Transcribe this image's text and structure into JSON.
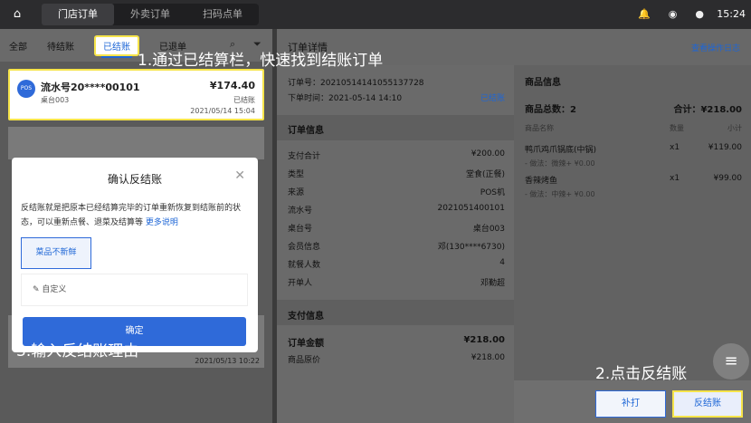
{
  "topbar": {
    "tabs": [
      "门店订单",
      "外卖订单",
      "扫码点单"
    ],
    "time": "15:24"
  },
  "left": {
    "tabs": [
      "全部",
      "待结账",
      "已结账",
      "已退单"
    ],
    "card": {
      "badge": "POS",
      "serial": "流水号20****00101",
      "table": "桌台003",
      "amount": "¥174.40",
      "status": "已结账",
      "time": "2021/05/14 15:04"
    },
    "ghost_time": "2021/05/13 10:22",
    "dialog": {
      "title": "确认反结账",
      "desc": "反结账就是把原本已经结算完毕的订单重新恢复到结账前的状态，可以重新点餐、退菜及结算等",
      "link": "更多说明",
      "reason": "菜品不新鲜",
      "custom": "自定义",
      "confirm": "确定"
    }
  },
  "right": {
    "title": "订单详情",
    "log_link": "查看操作日志",
    "order_no": "订单号：20210514141055137728",
    "order_time": "下单时间：2021-05-14 14:10",
    "status": "已结账",
    "info_title": "订单信息",
    "info": [
      {
        "k": "支付合计",
        "v": "¥200.00"
      },
      {
        "k": "类型",
        "v": "堂食(正餐)"
      },
      {
        "k": "来源",
        "v": "POS机"
      },
      {
        "k": "流水号",
        "v": "2021051400101"
      },
      {
        "k": "桌台号",
        "v": "桌台003"
      },
      {
        "k": "会员信息",
        "v": "邓(130****6730)"
      },
      {
        "k": "就餐人数",
        "v": "4"
      },
      {
        "k": "开单人",
        "v": "邓勤超"
      }
    ],
    "pay_title": "支付信息",
    "pay": [
      {
        "k": "订单金额",
        "v": "¥218.00"
      },
      {
        "k": "商品原价",
        "v": "¥218.00"
      }
    ],
    "goods_title": "商品信息",
    "goods_count": "商品总数：2",
    "goods_total": "合计：¥218.00",
    "goods_head": {
      "name": "商品名称",
      "qty": "数量",
      "sub": "小计"
    },
    "goods": [
      {
        "name": "鸭爪鸡爪锅底(中锅)",
        "qty": "x1",
        "price": "¥119.00",
        "note": "- 做法：微辣+ ¥0.00"
      },
      {
        "name": "香辣烤鱼",
        "qty": "x1",
        "price": "¥99.00",
        "note": "- 做法：中辣+ ¥0.00"
      }
    ],
    "btn_print": "补打",
    "btn_reverse": "反结账"
  },
  "annotations": [
    "1.通过已结算栏，快速找到结账订单",
    "2.点击反结账",
    "3.输入反结账理由"
  ]
}
